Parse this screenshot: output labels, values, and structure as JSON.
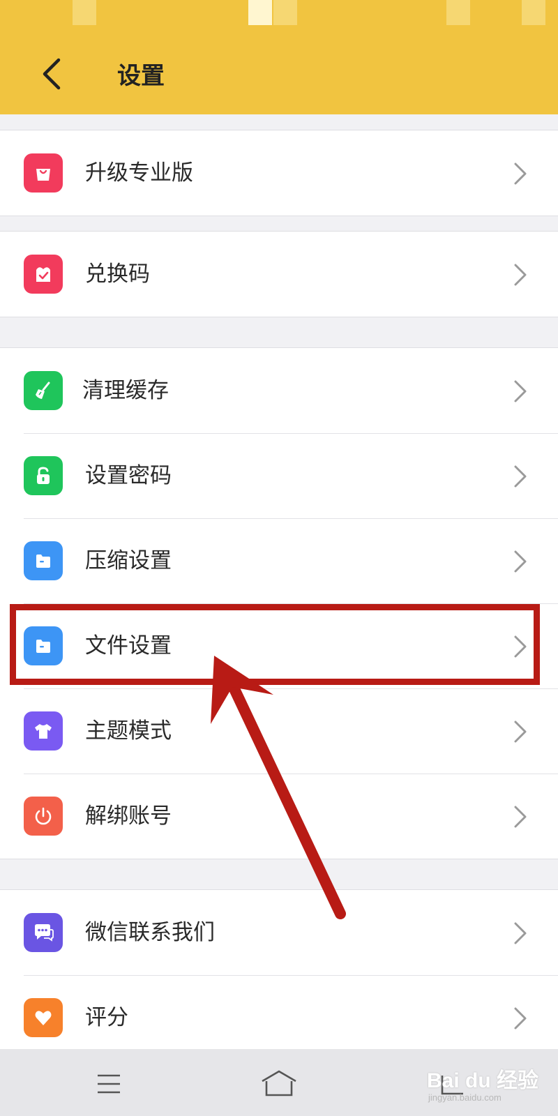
{
  "header": {
    "title": "设置",
    "back_icon": "chevron-left-icon",
    "background_color": "#f1c440"
  },
  "groups": [
    {
      "items": [
        {
          "label": "升级专业版",
          "icon": "shopping-bag-icon",
          "icon_color": "#f23b5c"
        }
      ]
    },
    {
      "items": [
        {
          "label": "兑换码",
          "icon": "gift-check-icon",
          "icon_color": "#f23b5c"
        }
      ]
    },
    {
      "items": [
        {
          "label": "清理缓存",
          "icon": "broom-icon",
          "icon_color": "#1fc55b"
        },
        {
          "label": "设置密码",
          "icon": "unlock-icon",
          "icon_color": "#1fc55b"
        },
        {
          "label": "压缩设置",
          "icon": "folder-icon",
          "icon_color": "#3d95f5"
        },
        {
          "label": "文件设置",
          "icon": "folder-icon",
          "icon_color": "#3d95f5"
        },
        {
          "label": "主题模式",
          "icon": "tshirt-icon",
          "icon_color": "#7a5af2"
        },
        {
          "label": "解绑账号",
          "icon": "power-icon",
          "icon_color": "#f3604a"
        }
      ]
    },
    {
      "items": [
        {
          "label": "微信联系我们",
          "icon": "chat-bubble-icon",
          "icon_color": "#6a55e3"
        },
        {
          "label": "评分",
          "icon": "heart-icon",
          "icon_color": "#f7812b"
        }
      ]
    }
  ],
  "annotation": {
    "highlighted_item": "文件设置",
    "color": "#b81b15"
  },
  "bottom_nav": {
    "buttons": [
      "menu-icon",
      "home-icon",
      "back-icon"
    ]
  },
  "watermark": {
    "logo": "Bai du 经验",
    "url": "jingyan.baidu.com"
  }
}
